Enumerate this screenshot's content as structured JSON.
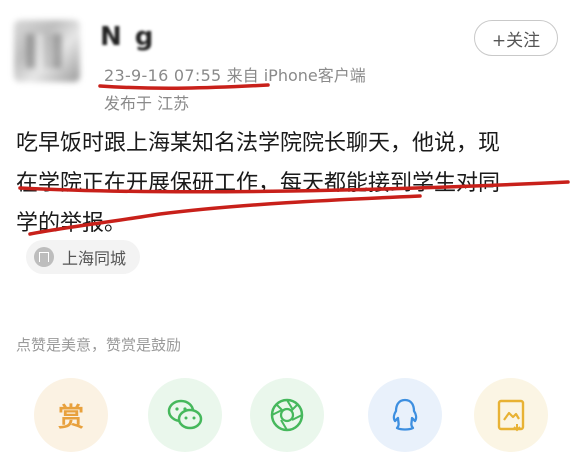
{
  "header": {
    "username": "N   g",
    "time": "23-9-16 07:55",
    "source": "来自 iPhone客户端",
    "location": "发布于 江苏",
    "follow_label": "+关注"
  },
  "post": {
    "line1": "吃早饭时跟上海某知名法学院院长聊天，他说，现",
    "line2": "在学院正在开展保研工作，每天都能接到学生对同",
    "line3": "学的举报。"
  },
  "tag": {
    "label": "上海同城"
  },
  "tip": "点赞是美意，赞赏是鼓励",
  "actions": {
    "reward_label": "赏"
  },
  "colors": {
    "highlight": "#c8201a",
    "reward": "#e8a13d",
    "green": "#46b85c",
    "blue": "#3d8fe0",
    "yellow": "#e8b234"
  },
  "icons": [
    "reward-icon",
    "wechat-icon",
    "moments-icon",
    "qq-icon",
    "save-image-icon"
  ]
}
